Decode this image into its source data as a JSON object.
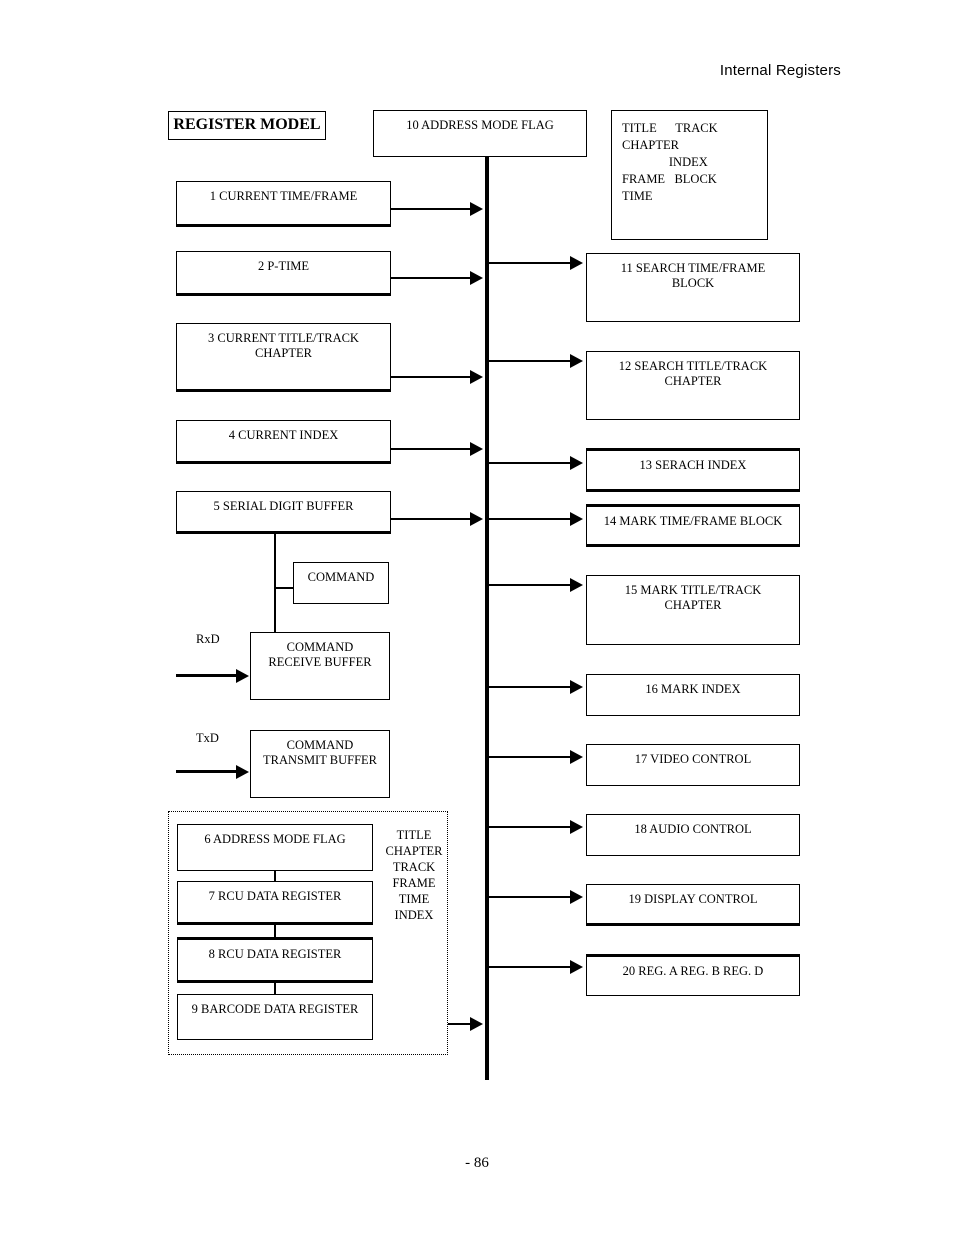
{
  "page": {
    "header": "Internal Registers",
    "footer": "- 86",
    "title_block": "REGISTER MODEL"
  },
  "legend": {
    "lines": [
      "TITLE      TRACK",
      "CHAPTER",
      "               INDEX",
      "FRAME   BLOCK",
      "TIME"
    ]
  },
  "bus_source": {
    "label": "10 ADDRESS MODE FLAG"
  },
  "left_registers": [
    {
      "label": "1 CURRENT TIME/FRAME"
    },
    {
      "label": "2 P-TIME"
    },
    {
      "label": "3 CURRENT TITLE/TRACK\nCHAPTER"
    },
    {
      "label": "4 CURRENT INDEX"
    },
    {
      "label": "5 SERIAL DIGIT BUFFER"
    }
  ],
  "command_blocks": {
    "command": "COMMAND",
    "receive_buffer": "COMMAND\nRECEIVE BUFFER",
    "transmit_buffer": "COMMAND\nTRANSMIT BUFFER",
    "rxd_label": "RxD",
    "txd_label": "TxD"
  },
  "dotted_group": {
    "registers": [
      {
        "label": "6 ADDRESS MODE FLAG"
      },
      {
        "label": "7 RCU DATA REGISTER"
      },
      {
        "label": "8 RCU DATA REGISTER"
      },
      {
        "label": "9 BARCODE DATA REGISTER"
      }
    ],
    "side_labels": [
      "TITLE",
      "CHAPTER",
      "TRACK",
      "FRAME",
      "TIME",
      "INDEX"
    ]
  },
  "right_registers": [
    {
      "label": "11 SEARCH TIME/FRAME\nBLOCK"
    },
    {
      "label": "12 SEARCH TITLE/TRACK\nCHAPTER"
    },
    {
      "label": "13 SERACH INDEX"
    },
    {
      "label": "14 MARK TIME/FRAME BLOCK"
    },
    {
      "label": "15 MARK TITLE/TRACK\nCHAPTER"
    },
    {
      "label": "16 MARK INDEX"
    },
    {
      "label": "17 VIDEO CONTROL"
    },
    {
      "label": "18 AUDIO CONTROL"
    },
    {
      "label": "19 DISPLAY CONTROL"
    },
    {
      "label": "20 REG. A  REG. B  REG. D"
    }
  ],
  "colors": {
    "ink": "#000000",
    "paper": "#ffffff"
  }
}
